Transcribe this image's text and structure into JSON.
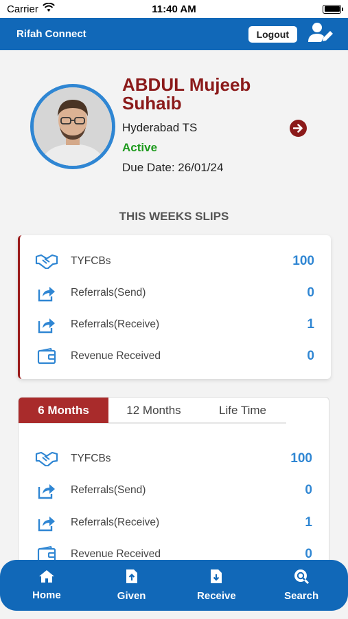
{
  "status_bar": {
    "carrier": "Carrier",
    "time": "11:40 AM"
  },
  "header": {
    "title": "Rifah Connect",
    "logout_label": "Logout"
  },
  "profile": {
    "name": "ABDUL Mujeeb Suhaib",
    "location": "Hyderabad TS",
    "status": "Active",
    "due_date": "Due Date: 26/01/24"
  },
  "weekly": {
    "title": "THIS WEEKS SLIPS",
    "rows": [
      {
        "icon": "handshake-icon",
        "label": "TYFCBs",
        "value": "100"
      },
      {
        "icon": "share-icon",
        "label": "Referrals(Send)",
        "value": "0"
      },
      {
        "icon": "share-icon",
        "label": "Referrals(Receive)",
        "value": "1"
      },
      {
        "icon": "wallet-icon",
        "label": "Revenue Received",
        "value": "0"
      }
    ]
  },
  "period": {
    "tabs": [
      "6 Months",
      "12 Months",
      "Life Time"
    ],
    "active_tab": "6 Months",
    "rows": [
      {
        "icon": "handshake-icon",
        "label": "TYFCBs",
        "value": "100"
      },
      {
        "icon": "share-icon",
        "label": "Referrals(Send)",
        "value": "0"
      },
      {
        "icon": "share-icon",
        "label": "Referrals(Receive)",
        "value": "1"
      },
      {
        "icon": "wallet-icon",
        "label": "Revenue Received",
        "value": "0"
      }
    ]
  },
  "bottom_nav": [
    {
      "icon": "home-icon",
      "label": "Home"
    },
    {
      "icon": "upload-file-icon",
      "label": "Given"
    },
    {
      "icon": "download-file-icon",
      "label": "Receive"
    },
    {
      "icon": "search-file-icon",
      "label": "Search"
    }
  ],
  "colors": {
    "primary": "#1168b8",
    "accent": "#8b1a1a",
    "active": "#1d9a1d",
    "value": "#2f86d3"
  }
}
